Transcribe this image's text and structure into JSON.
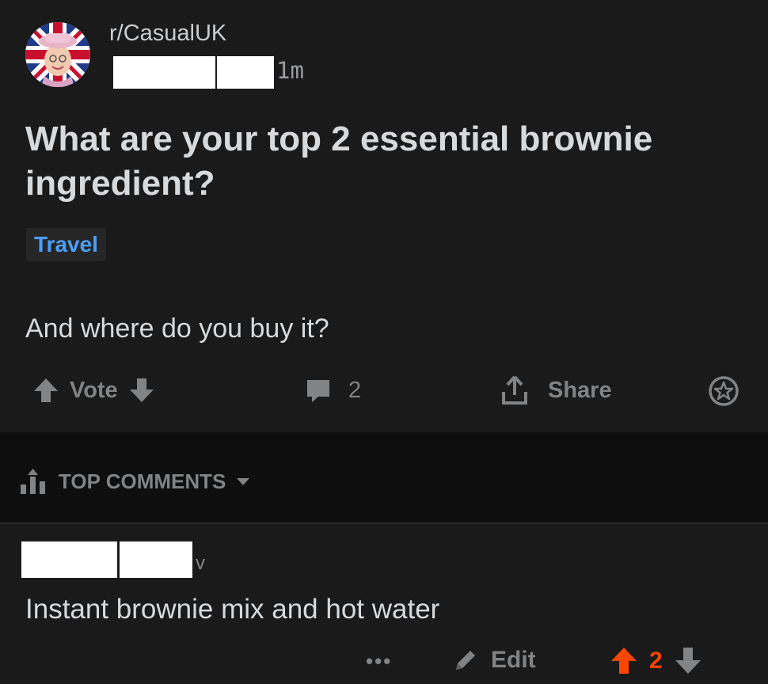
{
  "post": {
    "subreddit": "r/CasualUK",
    "time_ago": "1m",
    "title": "What are your top 2 essential brownie ingredient?",
    "flair": "Travel",
    "body": "And where do you buy it?",
    "actions": {
      "vote_label": "Vote",
      "comment_count": "2",
      "share_label": "Share"
    }
  },
  "comments_section": {
    "sort_label": "TOP COMMENTS"
  },
  "comment": {
    "meta_suffix": "v",
    "text": "Instant brownie mix and hot water",
    "more_label": "•••",
    "edit_label": "Edit",
    "vote_count": "2"
  },
  "colors": {
    "background": "#1a1a1b",
    "bar_background": "#0e0e0f",
    "flair_text": "#4a9ff5",
    "upvote_active": "#ff4500",
    "muted": "#818384"
  },
  "icons": [
    "avatar-queen-union-jack",
    "upvote-icon",
    "downvote-icon",
    "comment-icon",
    "share-icon",
    "award-icon",
    "sort-bars-icon",
    "chevron-down-icon",
    "pencil-icon"
  ]
}
